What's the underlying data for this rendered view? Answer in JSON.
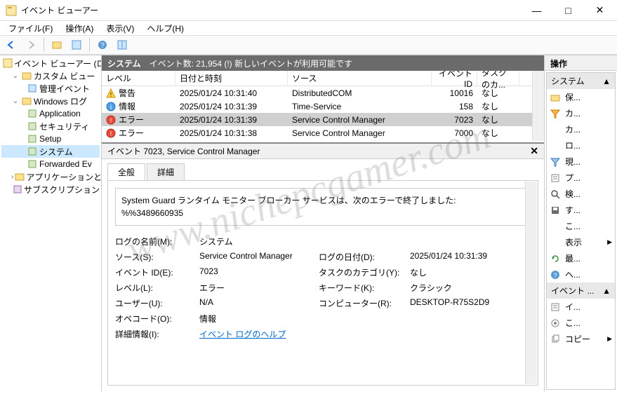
{
  "window": {
    "title": "イベント ビューアー"
  },
  "menu": {
    "file": "ファイル(F)",
    "action": "操作(A)",
    "view": "表示(V)",
    "help": "ヘルプ(H)"
  },
  "tree": {
    "root": "イベント ビューアー (ローカ",
    "custom_view": "カスタム ビュー",
    "admin_events": "管理イベント",
    "windows_log": "Windows ログ",
    "application": "Application",
    "security": "セキュリティ",
    "setup": "Setup",
    "system": "システム",
    "forwarded": "Forwarded Ev",
    "app_service": "アプリケーションとサ",
    "subscription": "サブスクリプション"
  },
  "center": {
    "header_name": "システム",
    "header_count": "イベント数: 21,954 (!) 新しいイベントが利用可能です"
  },
  "list": {
    "headers": {
      "level": "レベル",
      "date": "日付と時刻",
      "source": "ソース",
      "id": "イベント ID",
      "cat": "タスクのカ..."
    },
    "rows": [
      {
        "level": "警告",
        "icon": "warn",
        "date": "2025/01/24 10:31:40",
        "source": "DistributedCOM",
        "id": "10016",
        "cat": "なし"
      },
      {
        "level": "情報",
        "icon": "info",
        "date": "2025/01/24 10:31:39",
        "source": "Time-Service",
        "id": "158",
        "cat": "なし"
      },
      {
        "level": "エラー",
        "icon": "err",
        "date": "2025/01/24 10:31:39",
        "source": "Service Control Manager",
        "id": "7023",
        "cat": "なし",
        "sel": true
      },
      {
        "level": "エラー",
        "icon": "err",
        "date": "2025/01/24 10:31:38",
        "source": "Service Control Manager",
        "id": "7000",
        "cat": "なし"
      }
    ]
  },
  "detail": {
    "title": "イベント 7023, Service Control Manager",
    "tab_general": "全般",
    "tab_detail": "詳細",
    "message_l1": "System Guard ランタイム モニター ブローカー サービスは、次のエラーで終了しました:",
    "message_l2": "%%3489660935",
    "props": {
      "log_name_l": "ログの名前(M):",
      "log_name_v": "システム",
      "source_l": "ソース(S):",
      "source_v": "Service Control Manager",
      "log_date_l": "ログの日付(D):",
      "log_date_v": "2025/01/24 10:31:39",
      "event_id_l": "イベント ID(E):",
      "event_id_v": "7023",
      "task_cat_l": "タスクのカテゴリ(Y):",
      "task_cat_v": "なし",
      "level_l": "レベル(L):",
      "level_v": "エラー",
      "keyword_l": "キーワード(K):",
      "keyword_v": "クラシック",
      "user_l": "ユーザー(U):",
      "user_v": "N/A",
      "computer_l": "コンピューター(R):",
      "computer_v": "DESKTOP-R75S2D9",
      "opcode_l": "オペコード(O):",
      "opcode_v": "情報",
      "more_info_l": "詳細情報(I):",
      "more_info_v": "イベント ログのヘルプ"
    }
  },
  "actions": {
    "header": "操作",
    "group_system": "システム",
    "group_event": "イベント ...",
    "items1": [
      {
        "label": "保...",
        "icon": "open"
      },
      {
        "label": "カ...",
        "icon": "filter"
      },
      {
        "label": "カ...",
        "icon": ""
      },
      {
        "label": "ロ...",
        "icon": ""
      },
      {
        "label": "現...",
        "icon": "filter2"
      },
      {
        "label": "プ...",
        "icon": "props"
      },
      {
        "label": "検...",
        "icon": "find"
      },
      {
        "label": "す...",
        "icon": "save"
      },
      {
        "label": "こ...",
        "icon": ""
      },
      {
        "label": "表示",
        "icon": "",
        "sub": true
      },
      {
        "label": "最...",
        "icon": "refresh"
      },
      {
        "label": "ヘ...",
        "icon": "help"
      }
    ],
    "items2": [
      {
        "label": "イ...",
        "icon": "props"
      },
      {
        "label": "こ...",
        "icon": "attach"
      },
      {
        "label": "コピー",
        "icon": "copy",
        "sub": true
      }
    ]
  },
  "watermark": "www.nichepcgamer.com"
}
